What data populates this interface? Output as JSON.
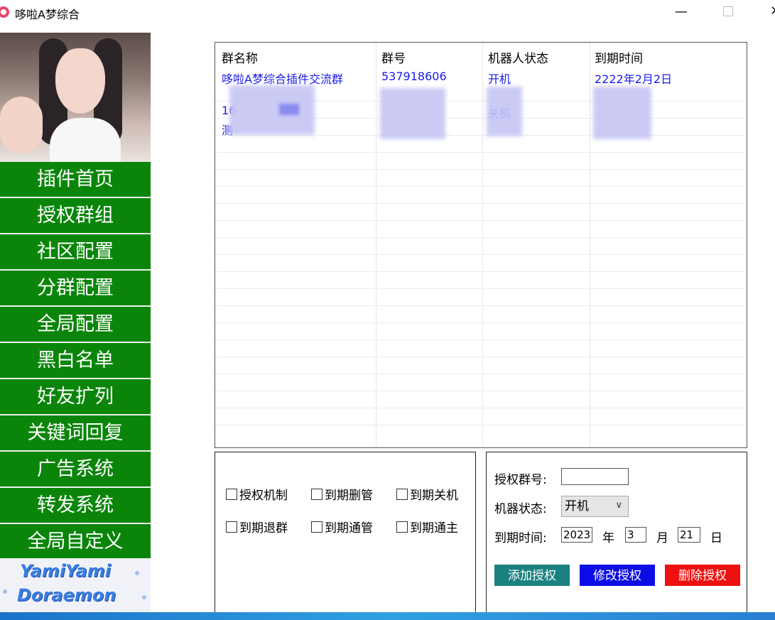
{
  "window": {
    "title": "哆啦A梦综合",
    "minimize": "—",
    "close": "×"
  },
  "sidebar": {
    "items": [
      "插件首页",
      "授权群组",
      "社区配置",
      "分群配置",
      "全局配置",
      "黑白名单",
      "好友扩列",
      "关键词回复",
      "广告系统",
      "转发系统",
      "全局自定义"
    ],
    "logo_line1": "YamiYami",
    "logo_line2": "Doraemon"
  },
  "table": {
    "headers": [
      "群名称",
      "群号",
      "机器人状态",
      "到期时间"
    ],
    "rows": [
      [
        "哆啦A梦综合插件交流群",
        "537918606",
        "开机",
        "2222年2月2日"
      ],
      [
        "",
        "",
        "",
        ""
      ],
      [
        "16",
        "",
        "关机",
        ""
      ],
      [
        "测",
        "",
        "",
        ""
      ]
    ]
  },
  "options": {
    "checkboxes": [
      "授权机制",
      "到期删管",
      "到期关机",
      "到期退群",
      "到期通管",
      "到期通主"
    ]
  },
  "form": {
    "group_label": "授权群号:",
    "group_value": "",
    "status_label": "机器状态:",
    "status_value": "开机",
    "expire_label": "到期时间:",
    "year_value": "2023",
    "year_unit": "年",
    "month_value": "3",
    "month_unit": "月",
    "day_value": "21",
    "day_unit": "日",
    "add_button": "添加授权",
    "edit_button": "修改授权",
    "delete_button": "删除授权"
  },
  "colors": {
    "nav_bg": "#0a850a",
    "link_text": "#1a1ae6",
    "add_btn": "#1a8080",
    "edit_btn": "#0c0ce6",
    "delete_btn": "#ee1111"
  }
}
